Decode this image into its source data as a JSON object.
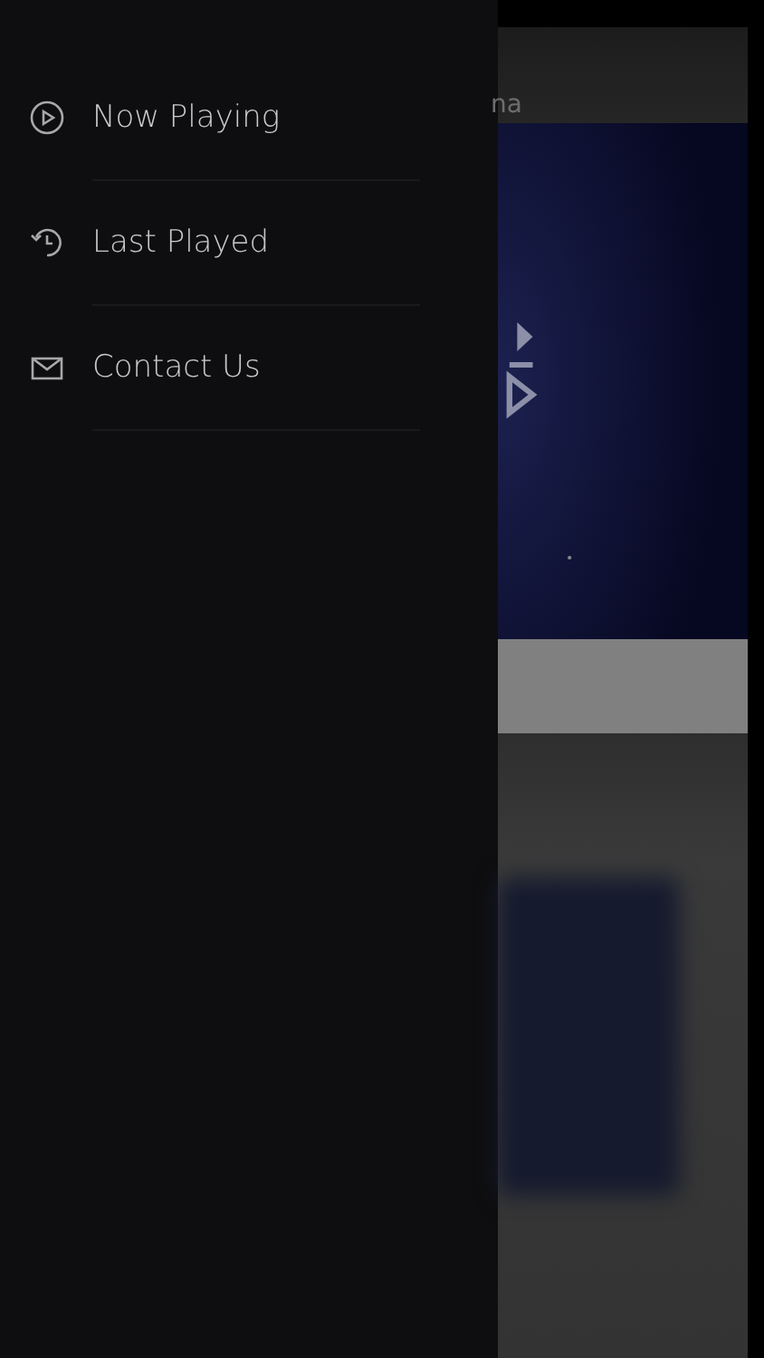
{
  "background_screen": {
    "header_text": "na"
  },
  "menu": {
    "items": [
      {
        "kind": "play",
        "label": "Now Playing"
      },
      {
        "kind": "history",
        "label": "Last Played"
      },
      {
        "kind": "mail",
        "label": "Contact Us"
      }
    ]
  }
}
